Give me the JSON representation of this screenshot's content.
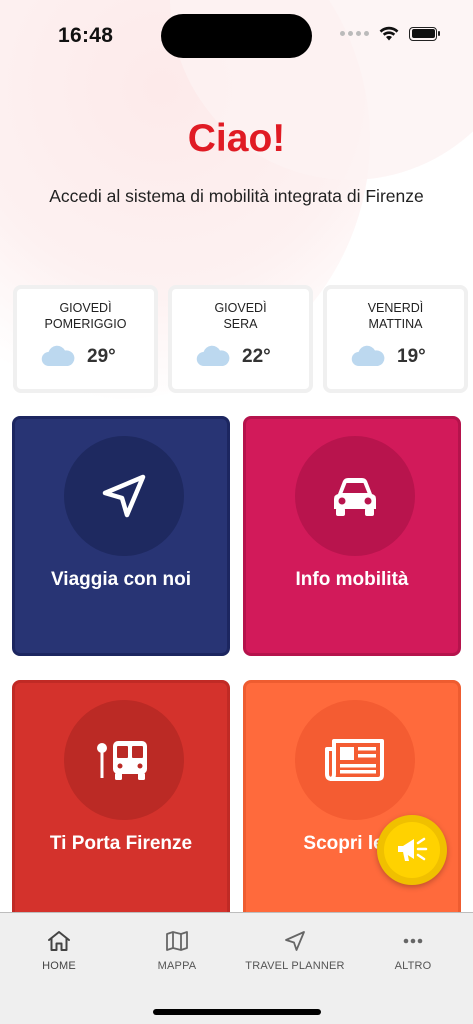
{
  "status_bar": {
    "time": "16:48"
  },
  "greeting": {
    "title": "Ciao!",
    "subtitle": "Accedi al sistema di mobilità integrata di Firenze"
  },
  "weather": [
    {
      "day_line1": "GIOVEDÌ",
      "day_line2": "POMERIGGIO",
      "temp": "29°",
      "icon": "cloud-icon"
    },
    {
      "day_line1": "GIOVEDÌ",
      "day_line2": "SERA",
      "temp": "22°",
      "icon": "cloud-icon"
    },
    {
      "day_line1": "VENERDÌ",
      "day_line2": "MATTINA",
      "temp": "19°",
      "icon": "cloud-icon"
    }
  ],
  "tiles": [
    {
      "label": "Viaggia con noi",
      "icon": "navigation-arrow-icon",
      "color": "#283474"
    },
    {
      "label": "Info mobilità",
      "icon": "car-icon",
      "color": "#d21a5a"
    },
    {
      "label": "Ti Porta Firenze",
      "icon": "bus-stop-icon",
      "color": "#d4322c"
    },
    {
      "label": "Scopri le n",
      "icon": "newspaper-icon",
      "color": "#ff6a3c"
    }
  ],
  "fab": {
    "icon": "megaphone-icon",
    "color": "#ffd200"
  },
  "nav": [
    {
      "label": "HOME",
      "icon": "home-icon"
    },
    {
      "label": "MAPPA",
      "icon": "map-icon"
    },
    {
      "label": "TRAVEL PLANNER",
      "icon": "navigation-arrow-icon"
    },
    {
      "label": "ALTRO",
      "icon": "more-dots-icon"
    }
  ]
}
